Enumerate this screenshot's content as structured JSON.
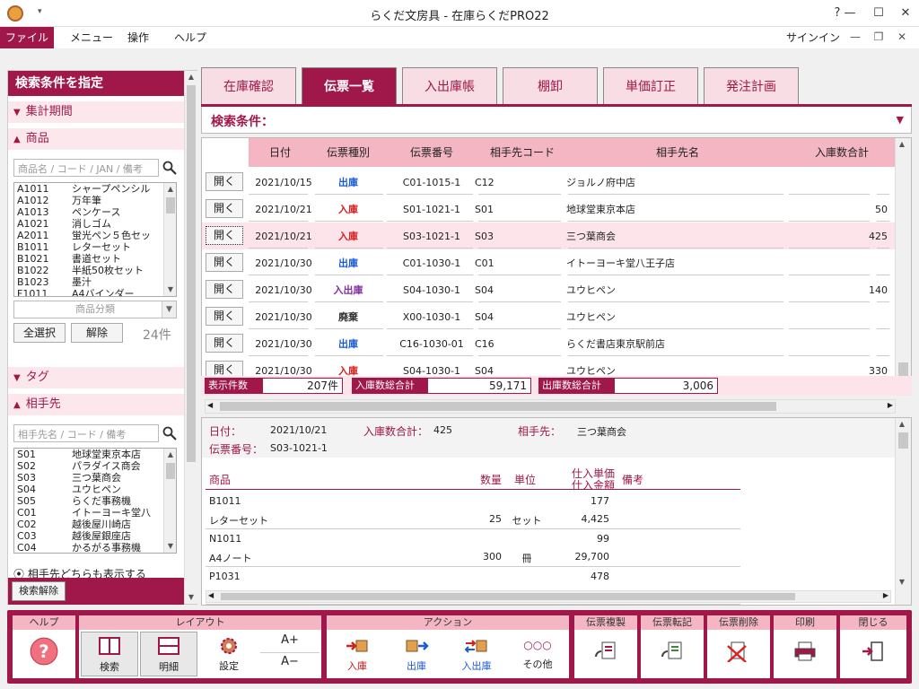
{
  "window": {
    "title": "らくだ文房具 - 在庫らくだPRO22",
    "help": "?",
    "min": "—",
    "max": "☐",
    "close": "✕",
    "qa": "▾"
  },
  "menu": {
    "file": "ファイル",
    "items": [
      "メニュー",
      "操作",
      "ヘルプ"
    ],
    "signin": "サインイン",
    "min": "—",
    "restore": "❐",
    "close": "✕"
  },
  "left": {
    "title": "検索条件を指定",
    "period": "集計期間",
    "product": "商品",
    "product_search_placeholder": "商品名 / コード / JAN / 備考",
    "products": [
      {
        "code": "A1011",
        "name": "シャープペンシル"
      },
      {
        "code": "A1012",
        "name": "万年筆"
      },
      {
        "code": "A1013",
        "name": "ペンケース"
      },
      {
        "code": "A1021",
        "name": "消しゴム"
      },
      {
        "code": "A2011",
        "name": "蛍光ペン５色セッ"
      },
      {
        "code": "B1011",
        "name": "レターセット"
      },
      {
        "code": "B1021",
        "name": "書道セット"
      },
      {
        "code": "B1022",
        "name": "半紙50枚セット"
      },
      {
        "code": "B1023",
        "name": "墨汁"
      },
      {
        "code": "F1011",
        "name": "A4バインダー"
      }
    ],
    "category": "商品分類",
    "select_all": "全選択",
    "clear": "解除",
    "count": "24件",
    "tag": "タグ",
    "partner": "相手先",
    "partner_search_placeholder": "相手先名 / コード / 備考",
    "partners": [
      {
        "code": "S01",
        "name": "地球堂東京本店"
      },
      {
        "code": "S02",
        "name": "パラダイス商会"
      },
      {
        "code": "S03",
        "name": "三つ葉商会"
      },
      {
        "code": "S04",
        "name": "ユウヒペン"
      },
      {
        "code": "S05",
        "name": "らくだ事務機"
      },
      {
        "code": "C01",
        "name": "イトーヨーキ堂八"
      },
      {
        "code": "C02",
        "name": "越後屋川崎店"
      },
      {
        "code": "C03",
        "name": "越後屋銀座店"
      },
      {
        "code": "C04",
        "name": "かるがる事務機"
      }
    ],
    "radio": "相手先どちらも表示する",
    "reset": "検索解除"
  },
  "tabs": [
    "在庫確認",
    "伝票一覧",
    "入出庫帳",
    "棚卸",
    "単価訂正",
    "発注計画"
  ],
  "active_tab": 1,
  "search_title": "検索条件：",
  "grid": {
    "headers": [
      "日付",
      "伝票種別",
      "伝票番号",
      "相手先コード",
      "相手先名",
      "入庫数合計"
    ],
    "open": "開く",
    "rows": [
      {
        "date": "2021/10/15",
        "type": "出庫",
        "no": "C01-1015-1",
        "pcode": "C12",
        "pname": "ジョルノ府中店",
        "qty": ""
      },
      {
        "date": "2021/10/21",
        "type": "入庫",
        "no": "S01-1021-1",
        "pcode": "S01",
        "pname": "地球堂東京本店",
        "qty": "50"
      },
      {
        "date": "2021/10/21",
        "type": "入庫",
        "no": "S03-1021-1",
        "pcode": "S03",
        "pname": "三つ葉商会",
        "qty": "425"
      },
      {
        "date": "2021/10/30",
        "type": "出庫",
        "no": "C01-1030-1",
        "pcode": "C01",
        "pname": "イトーヨーキ堂八王子店",
        "qty": ""
      },
      {
        "date": "2021/10/30",
        "type": "入出庫",
        "no": "S04-1030-1",
        "pcode": "S04",
        "pname": "ユウヒペン",
        "qty": "140"
      },
      {
        "date": "2021/10/30",
        "type": "廃棄",
        "no": "X00-1030-1",
        "pcode": "S04",
        "pname": "ユウヒペン",
        "qty": ""
      },
      {
        "date": "2021/10/30",
        "type": "出庫",
        "no": "C16-1030-01",
        "pcode": "C16",
        "pname": "らくだ書店東京駅前店",
        "qty": ""
      },
      {
        "date": "2021/10/30",
        "type": "入庫",
        "no": "S04-1030-1",
        "pcode": "S04",
        "pname": "ユウヒペン",
        "qty": "330"
      }
    ]
  },
  "totals": {
    "count_label": "表示件数",
    "count": "207件",
    "in_label": "入庫数総合計",
    "in": "59,171",
    "out_label": "出庫数総合計",
    "out": "3,006"
  },
  "detail": {
    "date_label": "日付：",
    "date": "2021/10/21",
    "in_label": "入庫数合計：",
    "in": "425",
    "partner_label": "相手先：",
    "partner": "三つ葉商会",
    "no_label": "伝票番号：",
    "no": "S03-1021-1",
    "headers": {
      "product": "商品",
      "qty": "数量",
      "unit": "単位",
      "price1": "仕入単価",
      "price2": "仕入金額",
      "note": "備考"
    },
    "rows": [
      {
        "code": "B1011",
        "name": "レターセット",
        "qty": "25",
        "unit": "セット",
        "price": "177",
        "amount": "4,425"
      },
      {
        "code": "N1011",
        "name": "A4ノート",
        "qty": "300",
        "unit": "冊",
        "price": "99",
        "amount": "29,700"
      },
      {
        "code": "P1031",
        "name": "",
        "qty": "",
        "unit": "",
        "price": "478",
        "amount": ""
      }
    ]
  },
  "toolbar": {
    "help": "ヘルプ",
    "layout": "レイアウト",
    "search": "検索",
    "detail": "明細",
    "settings": "設定",
    "font_up": "A+",
    "font_down": "A−",
    "action": "アクション",
    "in": "入庫",
    "out": "出庫",
    "inout": "入出庫",
    "other": "その他",
    "other_glyph": "○○○",
    "copy": "伝票複製",
    "transfer": "伝票転記",
    "delete": "伝票削除",
    "print": "印刷",
    "close": "閉じる"
  }
}
